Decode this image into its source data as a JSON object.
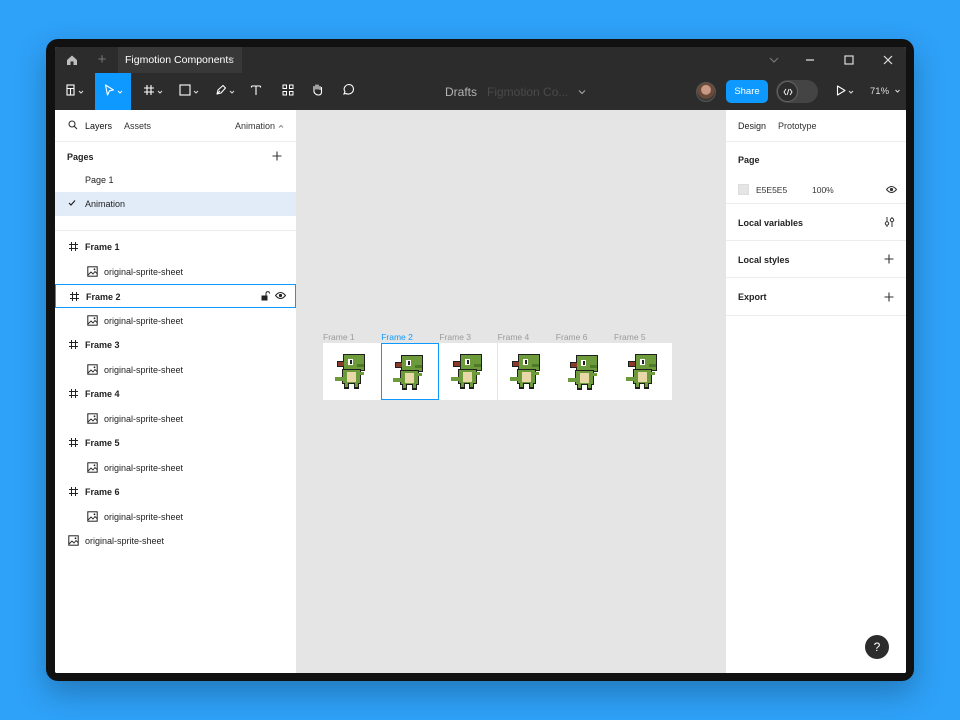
{
  "titlebar": {
    "tab_title": "Figmotion Components",
    "tab_close": "×",
    "new_tab": "+"
  },
  "toolbar": {
    "breadcrumb_drafts": "Drafts",
    "breadcrumb_file": "Figmotion Co...",
    "share_label": "Share",
    "zoom": "71%",
    "accent": "#0d99ff"
  },
  "left_panel": {
    "tabs": {
      "layers": "Layers",
      "assets": "Assets",
      "page_selector": "Animation"
    },
    "pages_title": "Pages",
    "pages": [
      {
        "label": "Page 1",
        "selected": false
      },
      {
        "label": "Animation",
        "selected": true
      }
    ],
    "layers": [
      {
        "label": "Frame 1",
        "kind": "frame"
      },
      {
        "label": "original-sprite-sheet",
        "kind": "child"
      },
      {
        "label": "Frame 2",
        "kind": "frame",
        "selected": true
      },
      {
        "label": "original-sprite-sheet",
        "kind": "child"
      },
      {
        "label": "Frame 3",
        "kind": "frame"
      },
      {
        "label": "original-sprite-sheet",
        "kind": "child"
      },
      {
        "label": "Frame 4",
        "kind": "frame"
      },
      {
        "label": "original-sprite-sheet",
        "kind": "child"
      },
      {
        "label": "Frame 5",
        "kind": "frame"
      },
      {
        "label": "original-sprite-sheet",
        "kind": "child"
      },
      {
        "label": "Frame 6",
        "kind": "frame"
      },
      {
        "label": "original-sprite-sheet",
        "kind": "child"
      },
      {
        "label": "original-sprite-sheet",
        "kind": "root"
      }
    ]
  },
  "canvas": {
    "background": "#E5E5E5",
    "frames": [
      {
        "label": "Frame 1",
        "selected": false
      },
      {
        "label": "Frame 2",
        "selected": true
      },
      {
        "label": "Frame 3",
        "selected": false
      },
      {
        "label": "Frame 4",
        "selected": false
      },
      {
        "label": "Frame 6",
        "selected": false
      },
      {
        "label": "Frame 5",
        "selected": false
      }
    ]
  },
  "right_panel": {
    "tabs": {
      "design": "Design",
      "prototype": "Prototype"
    },
    "page_section": {
      "title": "Page",
      "color_hex": "E5E5E5",
      "opacity": "100%"
    },
    "local_variables": "Local variables",
    "local_styles": "Local styles",
    "export": "Export"
  },
  "help_label": "?"
}
